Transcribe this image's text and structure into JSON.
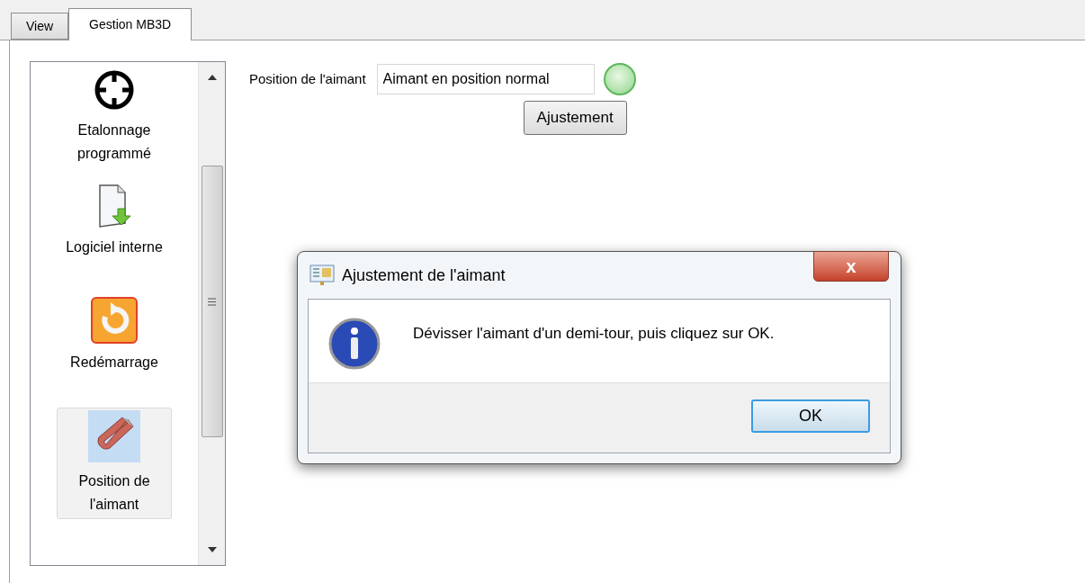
{
  "tabs": [
    {
      "label": "View",
      "selected": false
    },
    {
      "label": "Gestion MB3D",
      "selected": true
    }
  ],
  "sidebar": {
    "items": [
      {
        "kind": "crosshair",
        "label": "Etalonnage programmé",
        "selected": false
      },
      {
        "kind": "document",
        "label": "Logiciel interne",
        "selected": false
      },
      {
        "kind": "restart",
        "label": "Redémarrage",
        "selected": false
      },
      {
        "kind": "magnet",
        "label": "Position de l'aimant",
        "selected": true
      }
    ]
  },
  "magnet_position": {
    "label": "Position de l'aimant",
    "value": "Aimant en position normal",
    "indicator_on": true,
    "button": "Ajustement"
  },
  "dialog": {
    "title": "Ajustement de l'aimant",
    "close": "x",
    "message": "Dévisser l'aimant d'un demi-tour, puis cliquez sur OK.",
    "button": "OK"
  }
}
